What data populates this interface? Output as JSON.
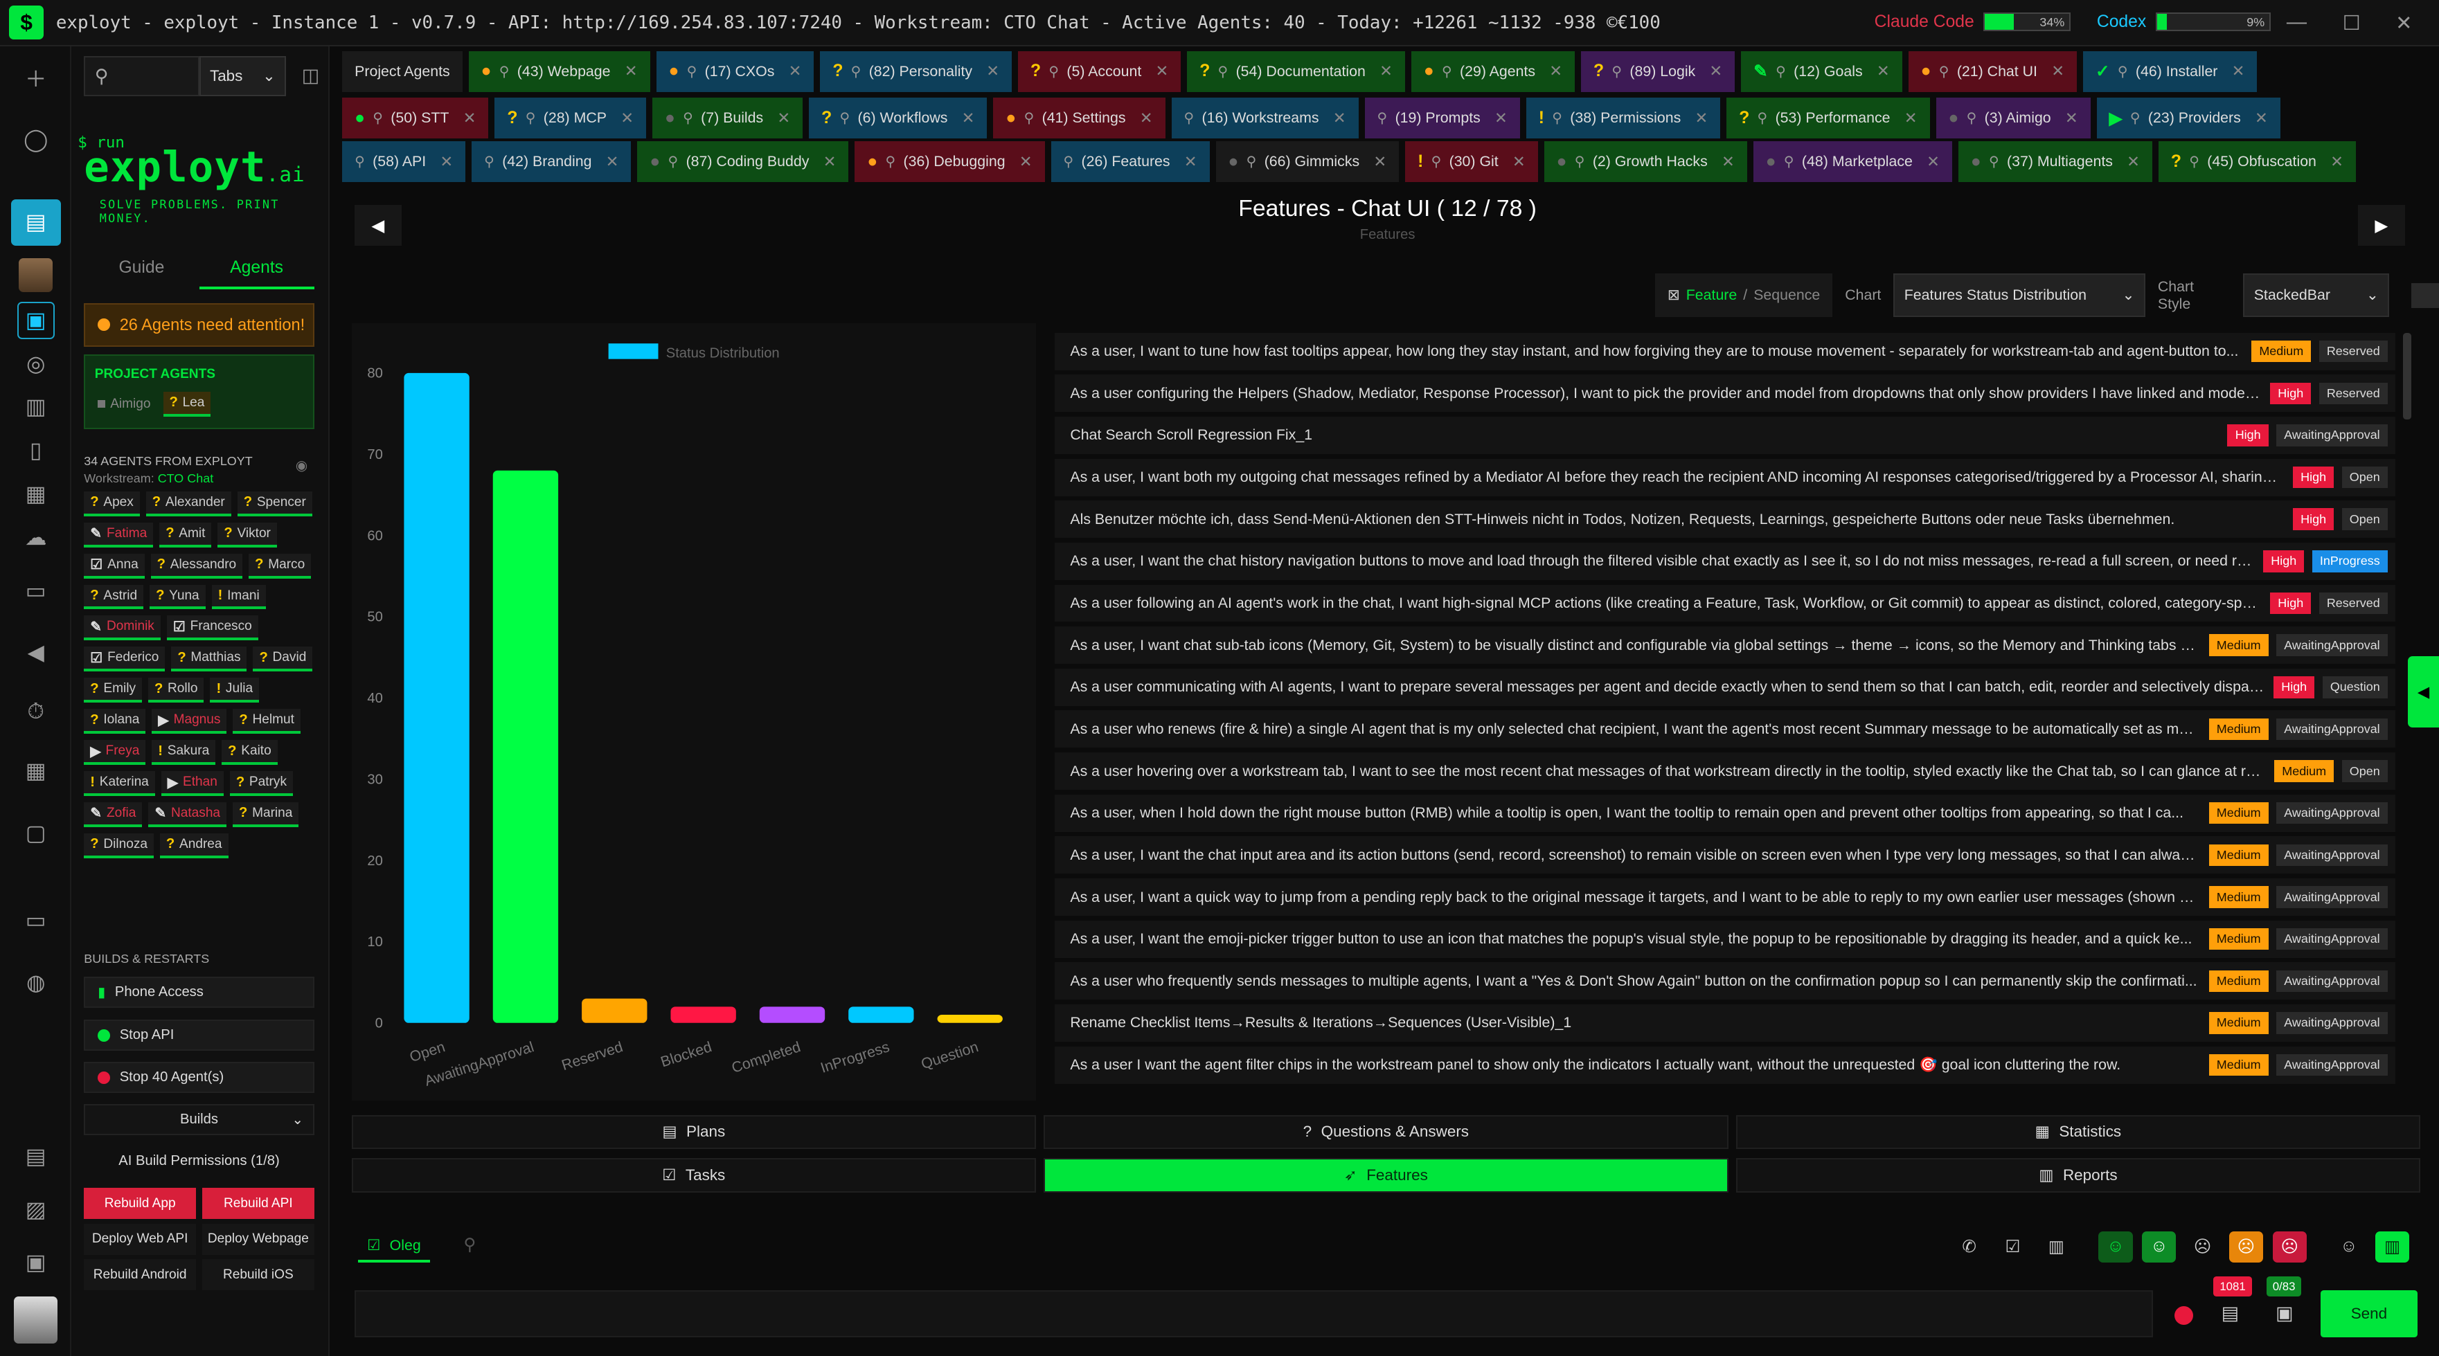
{
  "titlebar": {
    "title": "exployt - exployt - Instance 1 - v0.7.9 - API: http://169.254.83.107:7240 - Workstream: CTO Chat - Active Agents: 40 - Today: +12261 ~1132 -938 ©€100",
    "claude_label": "Claude Code",
    "claude_pct": "34%",
    "claude_fraction": 0.34,
    "codex_label": "Codex",
    "codex_pct": "9%",
    "codex_fraction": 0.09
  },
  "leftpanel": {
    "tabs_select": "Tabs",
    "brand_run": "$ run",
    "brand_name": "exployt",
    "brand_ai": ".ai",
    "brand_tagline": "SOLVE PROBLEMS. PRINT MONEY.",
    "subtab_guide": "Guide",
    "subtab_agents": "Agents",
    "attention": "26 Agents need attention!",
    "project_agents_heading": "PROJECT AGENTS",
    "project_agents": [
      "Aimigo",
      "Lea"
    ],
    "agents_from": "34  AGENTS FROM  EXPLOYT",
    "workstream_label": "Workstream:",
    "workstream_value": "CTO Chat",
    "agents": [
      {
        "name": "Apex",
        "type": "q"
      },
      {
        "name": "Alexander",
        "type": "q"
      },
      {
        "name": "Spencer",
        "type": "q"
      },
      {
        "name": "Fatima",
        "type": "pen-red"
      },
      {
        "name": "Amit",
        "type": "q"
      },
      {
        "name": "Viktor",
        "type": "q"
      },
      {
        "name": "Anna",
        "type": "check"
      },
      {
        "name": "Alessandro",
        "type": "q"
      },
      {
        "name": "Marco",
        "type": "q"
      },
      {
        "name": "Astrid",
        "type": "q"
      },
      {
        "name": "Yuna",
        "type": "q"
      },
      {
        "name": "Imani",
        "type": "ex"
      },
      {
        "name": "Dominik",
        "type": "pen-red"
      },
      {
        "name": "Francesco",
        "type": "check"
      },
      {
        "name": "Federico",
        "type": "check"
      },
      {
        "name": "Matthias",
        "type": "q"
      },
      {
        "name": "David",
        "type": "q"
      },
      {
        "name": "Emily",
        "type": "q"
      },
      {
        "name": "Rollo",
        "type": "q"
      },
      {
        "name": "Julia",
        "type": "ex"
      },
      {
        "name": "Iolana",
        "type": "q"
      },
      {
        "name": "Magnus",
        "type": "play-red"
      },
      {
        "name": "Helmut",
        "type": "q"
      },
      {
        "name": "Freya",
        "type": "play-red"
      },
      {
        "name": "Sakura",
        "type": "ex"
      },
      {
        "name": "Kaito",
        "type": "q"
      },
      {
        "name": "Katerina",
        "type": "ex"
      },
      {
        "name": "Ethan",
        "type": "play-red"
      },
      {
        "name": "Patryk",
        "type": "q"
      },
      {
        "name": "Zofia",
        "type": "pen-red"
      },
      {
        "name": "Natasha",
        "type": "pen-red"
      },
      {
        "name": "Marina",
        "type": "q"
      },
      {
        "name": "Dilnoza",
        "type": "q"
      },
      {
        "name": "Andrea",
        "type": "q"
      }
    ],
    "builds_heading": "BUILDS & RESTARTS",
    "phone_access": "Phone Access",
    "stop_api": "Stop API",
    "stop_agents": "Stop 40 Agent(s)",
    "builds_select": "Builds",
    "ai_build_permissions": "AI Build Permissions (1/8)",
    "rebuild_app": "Rebuild App",
    "rebuild_api": "Rebuild API",
    "deploy_web_api": "Deploy Web API",
    "deploy_webpage": "Deploy Webpage",
    "rebuild_android": "Rebuild Android",
    "rebuild_ios": "Rebuild iOS"
  },
  "tabs": {
    "row1": [
      {
        "label": "Project Agents",
        "status": "none",
        "color": "#1a1a1a"
      },
      {
        "label": "(43) Webpage",
        "status": "dot-orange",
        "color": "#0d4d14"
      },
      {
        "label": "(17) CXOs",
        "status": "dot-orange",
        "color": "#0d3f5a"
      },
      {
        "label": "(82) Personality",
        "status": "q",
        "color": "#0d3f5a"
      },
      {
        "label": "(5) Account",
        "status": "q",
        "color": "#5a0d1a"
      },
      {
        "label": "(54) Documentation",
        "status": "q",
        "color": "#0d4d14"
      },
      {
        "label": "(29) Agents",
        "status": "dot-orange",
        "color": "#0d4d14"
      },
      {
        "label": "(89) Logik",
        "status": "q",
        "color": "#3d1a55"
      },
      {
        "label": "(12) Goals",
        "status": "pen",
        "color": "#0d4d14"
      },
      {
        "label": "(21) Chat UI",
        "status": "dot-orange",
        "color": "#5a0d1a"
      },
      {
        "label": "(46) Installer",
        "status": "check",
        "color": "#0d3f5a"
      }
    ],
    "row2": [
      {
        "label": "(50) STT",
        "status": "dot-green",
        "color": "#5a0d1a"
      },
      {
        "label": "(28) MCP",
        "status": "q",
        "color": "#0d3f5a"
      },
      {
        "label": "(7) Builds",
        "status": "dot-dim",
        "color": "#0d4d14"
      },
      {
        "label": "(6) Workflows",
        "status": "q",
        "color": "#0d3f5a"
      },
      {
        "label": "(41) Settings",
        "status": "dot-orange",
        "color": "#5a0d1a"
      },
      {
        "label": "(16) Workstreams",
        "status": "none",
        "color": "#0d3f5a"
      },
      {
        "label": "(19) Prompts",
        "status": "none",
        "color": "#3d1a55"
      },
      {
        "label": "(38) Permissions",
        "status": "ex",
        "color": "#0d3f5a"
      },
      {
        "label": "(53) Performance",
        "status": "q",
        "color": "#0d4d14"
      },
      {
        "label": "(3) Aimigo",
        "status": "dot-dim",
        "color": "#3d1a55"
      },
      {
        "label": "(23) Providers",
        "status": "play",
        "color": "#0d3f5a"
      }
    ],
    "row3": [
      {
        "label": "(58) API",
        "status": "none",
        "color": "#0d3f5a"
      },
      {
        "label": "(42) Branding",
        "status": "none",
        "color": "#0d3f5a"
      },
      {
        "label": "(87) Coding Buddy",
        "status": "dot-dim",
        "color": "#0d4d14"
      },
      {
        "label": "(36) Debugging",
        "status": "dot-orange",
        "color": "#5a0d1a"
      },
      {
        "label": "(26) Features",
        "status": "none",
        "color": "#0d3f5a"
      },
      {
        "label": "(66) Gimmicks",
        "status": "dot-dim",
        "color": "#1a1a1a"
      },
      {
        "label": "(30) Git",
        "status": "ex",
        "color": "#5a0d1a"
      },
      {
        "label": "(2) Growth Hacks",
        "status": "dot-dim",
        "color": "#0d4d14"
      },
      {
        "label": "(48) Marketplace",
        "status": "dot-dim",
        "color": "#3d1a55"
      },
      {
        "label": "(37) Multiagents",
        "status": "dot-dim",
        "color": "#0d4d14"
      },
      {
        "label": "(45) Obfuscation",
        "status": "q",
        "color": "#0d4d14"
      }
    ]
  },
  "main": {
    "title": "Features -  Chat UI  ( 12 / 78 )",
    "subtitle": "Features",
    "seg_feature": "Feature",
    "seg_sep": "/",
    "seg_sequence": "Sequence",
    "chart_label": "Chart",
    "chart_value": "Features Status Distribution",
    "style_label": "Chart Style",
    "style_value": "StackedBar"
  },
  "chart_data": {
    "type": "bar",
    "categories": [
      "Open",
      "AwaitingApproval",
      "Reserved",
      "Blocked",
      "Completed",
      "InProgress",
      "Question"
    ],
    "series": [
      {
        "name": "Status Distribution",
        "values": [
          80,
          68,
          3,
          2,
          2,
          2,
          1
        ]
      }
    ],
    "colors": [
      "#00c8ff",
      "#00ff44",
      "#ffa500",
      "#ff1744",
      "#b44dff",
      "#00c8ff",
      "#ffd000"
    ],
    "ylim": [
      0,
      80
    ],
    "yticks": [
      0,
      10,
      20,
      30,
      40,
      50,
      60,
      70,
      80
    ]
  },
  "features": [
    {
      "text": "As a user, I want to tune how fast tooltips appear, how long they stay instant, and how forgiving they are to mouse movement - separately for workstream-tab and agent-button to...",
      "priority": "Medium",
      "status": "Reserved"
    },
    {
      "text": "As a user configuring the Helpers (Shadow, Mediator, Response Processor), I want to pick the provider and model from dropdowns that only show providers I have linked and models t...",
      "priority": "High",
      "status": "Reserved"
    },
    {
      "text": "Chat Search Scroll Regression Fix_1",
      "priority": "High",
      "status": "AwaitingApproval"
    },
    {
      "text": "As a user, I want both my outgoing chat messages refined by a Mediator AI before they reach the recipient AND incoming AI responses categorised/triggered by a Processor AI, sharing o...",
      "priority": "High",
      "status": "Open"
    },
    {
      "text": "Als Benutzer möchte ich, dass Send-Menü-Aktionen den STT-Hinweis nicht in Todos, Notizen, Requests, Learnings, gespeicherte Buttons oder neue Tasks übernehmen.",
      "priority": "High",
      "status": "Open"
    },
    {
      "text": "As a user, I want the chat history navigation buttons to move and load through the filtered visible chat exactly as I see it, so I do not miss messages, re-read a full screen, or need repe...",
      "priority": "High",
      "status": "InProgress"
    },
    {
      "text": "As a user following an AI agent's work in the chat, I want high-signal MCP actions (like creating a Feature, Task, Workflow, or Git commit) to appear as distinct, colored, category-specifi...",
      "priority": "High",
      "status": "Reserved"
    },
    {
      "text": "As a user, I want chat sub-tab icons (Memory, Git, System) to be visually distinct and configurable via global settings → theme → icons, so the Memory and Thinking tabs ar...",
      "priority": "Medium",
      "status": "AwaitingApproval"
    },
    {
      "text": "As a user communicating with AI agents, I want to prepare several messages per agent and decide exactly when to send them so that I can batch, edit, reorder and selectively dispatch i...",
      "priority": "High",
      "status": "Question"
    },
    {
      "text": "As a user who renews (fire & hire) a single AI agent that is my only selected chat recipient, I want the agent's most recent Summary message to be automatically set as my r...",
      "priority": "Medium",
      "status": "AwaitingApproval"
    },
    {
      "text": "As a user hovering over a workstream tab, I want to see the most recent chat messages of that workstream directly in the tooltip, styled exactly like the Chat tab, so I can glance at rece...",
      "priority": "Medium",
      "status": "Open"
    },
    {
      "text": "As a user, when I hold down the right mouse button (RMB) while a tooltip is open, I want the tooltip to remain open and prevent other tooltips from appearing, so that I ca...",
      "priority": "Medium",
      "status": "AwaitingApproval"
    },
    {
      "text": "As a user, I want the chat input area and its action buttons (send, record, screenshot) to remain visible on screen even when I type very long messages, so that I can always s...",
      "priority": "Medium",
      "status": "AwaitingApproval"
    },
    {
      "text": "As a user, I want a quick way to jump from a pending reply back to the original message it targets, and I want to be able to reply to my own earlier user messages (shown a...",
      "priority": "Medium",
      "status": "AwaitingApproval"
    },
    {
      "text": "As a user, I want the emoji-picker trigger button to use an icon that matches the popup's visual style, the popup to be repositionable by dragging its header, and a quick ke...",
      "priority": "Medium",
      "status": "AwaitingApproval"
    },
    {
      "text": "As a user who frequently sends messages to multiple agents, I want a \"Yes & Don't Show Again\" button on the confirmation popup so I can permanently skip the confirmati...",
      "priority": "Medium",
      "status": "AwaitingApproval"
    },
    {
      "text": "Rename Checklist Items→Results & Iterations→Sequences (User-Visible)_1",
      "priority": "Medium",
      "status": "AwaitingApproval"
    },
    {
      "text": "As a user I want the agent filter chips in the workstream panel to show only the indicators I actually want, without the unrequested 🎯 goal icon cluttering the row.",
      "priority": "Medium",
      "status": "AwaitingApproval"
    }
  ],
  "panels": {
    "plans": "Plans",
    "qa": "Questions & Answers",
    "statistics": "Statistics",
    "tasks": "Tasks",
    "features": "Features",
    "reports": "Reports"
  },
  "composer": {
    "recipient": "Oleg",
    "count_messages": "1081",
    "count_tasks": "0/83",
    "send": "Send"
  }
}
